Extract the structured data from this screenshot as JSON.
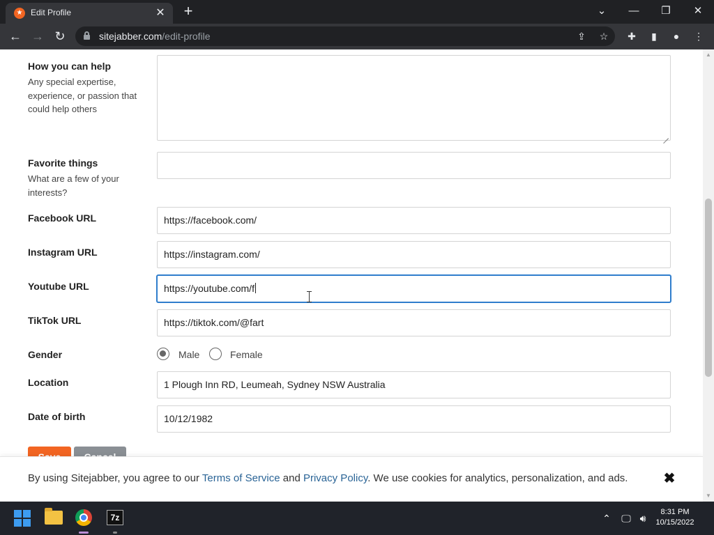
{
  "browser": {
    "tab_title": "Edit Profile",
    "url_domain": "sitejabber.com",
    "url_path": "/edit-profile"
  },
  "form": {
    "help": {
      "label": "How you can help",
      "description": "Any special expertise, experience, or passion that could help others",
      "value": ""
    },
    "favorites": {
      "label": "Favorite things",
      "description": "What are a few of your interests?",
      "value": ""
    },
    "facebook": {
      "label": "Facebook URL",
      "value": "https://facebook.com/"
    },
    "instagram": {
      "label": "Instagram URL",
      "value": "https://instagram.com/"
    },
    "youtube": {
      "label": "Youtube URL",
      "value": "https://youtube.com/f"
    },
    "tiktok": {
      "label": "TikTok URL",
      "value": "https://tiktok.com/@fart"
    },
    "gender": {
      "label": "Gender",
      "options": [
        "Male",
        "Female"
      ],
      "selected": "Male"
    },
    "location": {
      "label": "Location",
      "value": "1 Plough Inn RD, Leumeah, Sydney NSW Australia"
    },
    "dob": {
      "label": "Date of birth",
      "value": "10/12/1982"
    },
    "save_label": "Save",
    "cancel_label": "Cancel"
  },
  "cookie": {
    "text_1": "By using Sitejabber, you agree to our ",
    "terms_link": "Terms of Service",
    "text_2": " and ",
    "privacy_link": "Privacy Policy",
    "text_3": ". We use cookies for analytics, personalization, and ads.",
    "close_glyph": "✖"
  },
  "taskbar": {
    "time": "8:31 PM",
    "date": "10/15/2022",
    "archiver_label": "7z"
  },
  "colors": {
    "brand_orange": "#f26522",
    "link_blue": "#2a6496",
    "focus_blue": "#2f7dcc",
    "cancel_gray": "#8a8f94"
  }
}
